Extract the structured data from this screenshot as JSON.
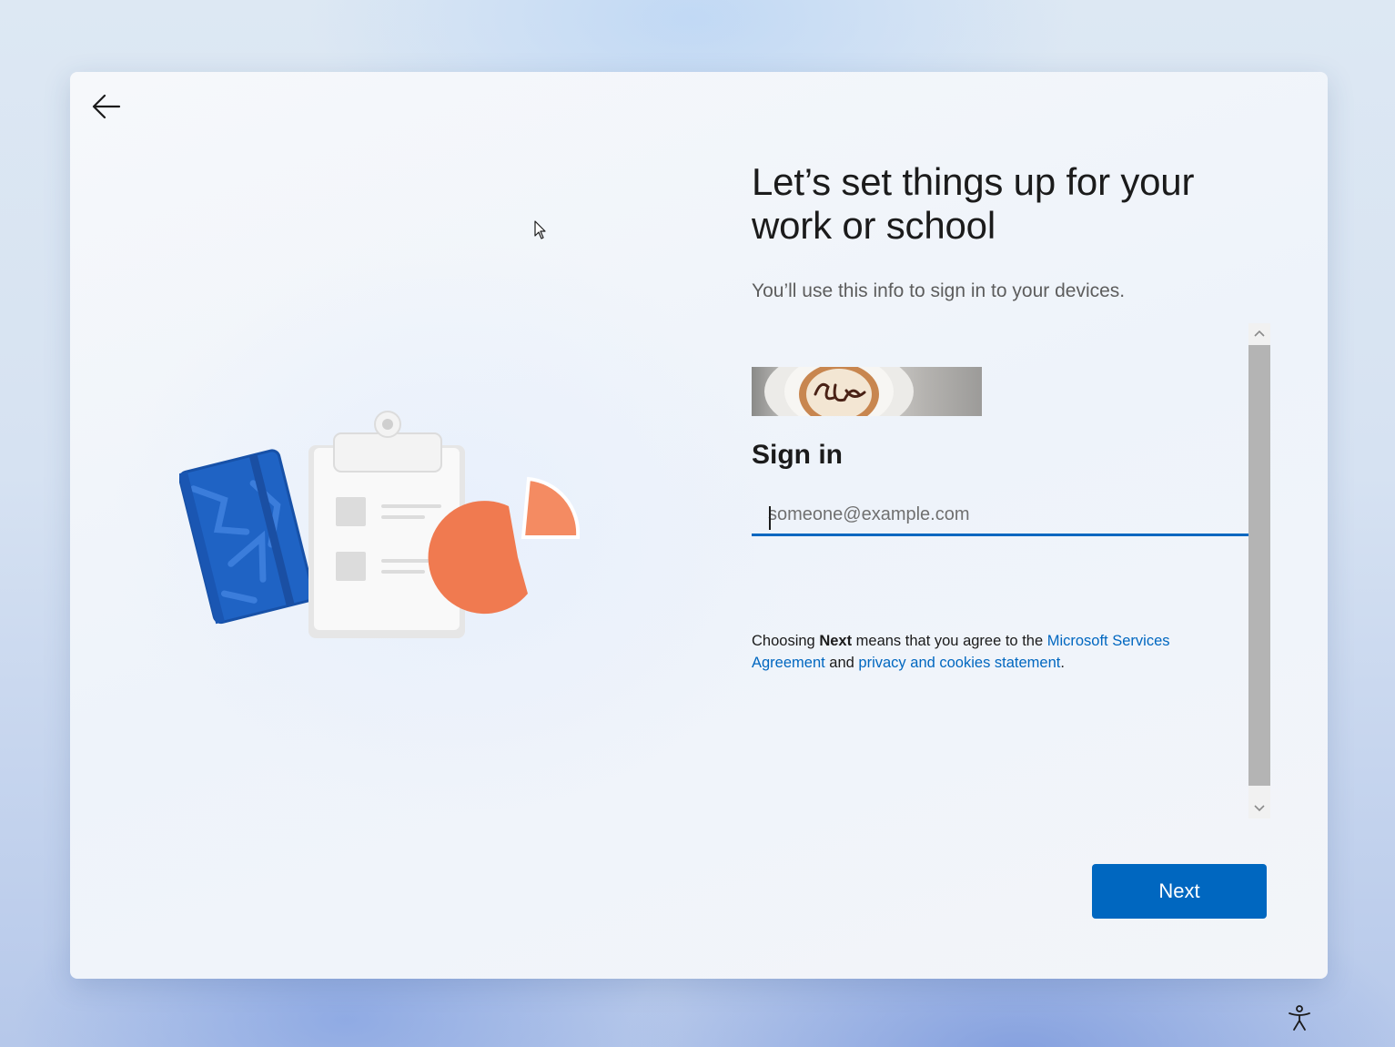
{
  "page": {
    "title": "Let’s set things up for your work or school",
    "subtitle": "You’ll use this info to sign in to your devices."
  },
  "navigation": {
    "back_icon": "arrow-left-icon"
  },
  "banner": {
    "text": "Coffee"
  },
  "signin": {
    "heading": "Sign in",
    "email_placeholder": "someone@example.com",
    "email_value": ""
  },
  "legal": {
    "prefix": "Choosing ",
    "bold": "Next",
    "middle": " means that you agree to the ",
    "link_agreement": "Microsoft Services Agreement",
    "and": " and ",
    "link_privacy": "privacy and cookies statement",
    "suffix": "."
  },
  "buttons": {
    "next_label": "Next"
  },
  "icons": {
    "accessibility": "accessibility-icon",
    "scroll_up": "chevron-up-icon",
    "scroll_down": "chevron-down-icon"
  },
  "colors": {
    "accent": "#0067c0",
    "notebook": "#1f63c4",
    "pie": "#f07a50"
  }
}
